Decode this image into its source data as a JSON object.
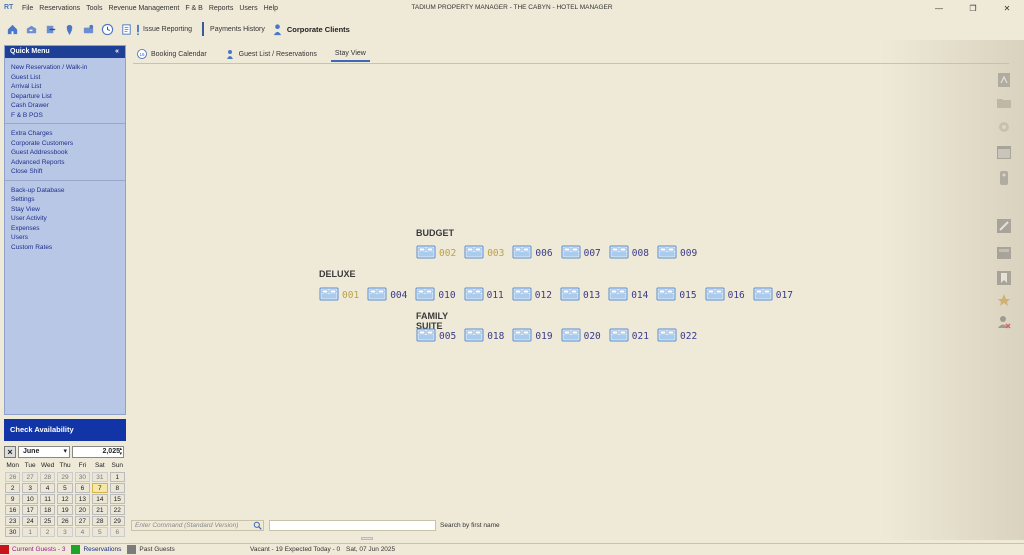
{
  "app": {
    "title": "TADIUM PROPERTY MANAGER - THE CABYN - HOTEL MANAGER",
    "logo": "RT"
  },
  "menu": [
    "File",
    "Reservations",
    "Tools",
    "Revenue Management",
    "F & B",
    "Reports",
    "Users",
    "Help"
  ],
  "window_controls": {
    "minimize": "—",
    "maximize": "❐",
    "close": "✕"
  },
  "toolbar": {
    "issue_reporting": "Issue Reporting",
    "payments_history": "Payments History",
    "corporate_clients": "Corporate Clients"
  },
  "quick_menu": {
    "title": "Quick Menu",
    "collapse": "«",
    "groups": [
      [
        "New Reservation / Walk-in",
        "Guest List",
        "Arrival List",
        "Departure List",
        "Cash Drawer",
        "F & B POS"
      ],
      [
        "Extra Charges",
        "Corporate Customers",
        "Guest Addressbook",
        "Advanced Reports",
        "Close Shift"
      ],
      [
        "Back-up Database",
        "Settings",
        "Stay View",
        "User Activity",
        "Expenses",
        "Users",
        "Custom Rates"
      ]
    ]
  },
  "check_availability": "Check Availability",
  "calendar": {
    "month": "June",
    "year": "2,025",
    "day_names": [
      "Mon",
      "Tue",
      "Wed",
      "Thu",
      "Fri",
      "Sat",
      "Sun"
    ],
    "weeks": [
      [
        "26",
        "27",
        "28",
        "29",
        "30",
        "31",
        "1"
      ],
      [
        "2",
        "3",
        "4",
        "5",
        "6",
        "7",
        "8"
      ],
      [
        "9",
        "10",
        "11",
        "12",
        "13",
        "14",
        "15"
      ],
      [
        "16",
        "17",
        "18",
        "19",
        "20",
        "21",
        "22"
      ],
      [
        "23",
        "24",
        "25",
        "26",
        "27",
        "28",
        "29"
      ],
      [
        "30",
        "1",
        "2",
        "3",
        "4",
        "5",
        "6"
      ]
    ],
    "today": "7"
  },
  "tabs": [
    "Booking Calendar",
    "Guest List / Reservations",
    "Stay View"
  ],
  "active_tab": "Stay View",
  "stay_view": {
    "categories": [
      {
        "name": "BUDGET",
        "rooms": [
          {
            "num": "002",
            "occupied": true
          },
          {
            "num": "003",
            "occupied": true
          },
          {
            "num": "006",
            "occupied": false
          },
          {
            "num": "007",
            "occupied": false
          },
          {
            "num": "008",
            "occupied": false
          },
          {
            "num": "009",
            "occupied": false
          }
        ]
      },
      {
        "name": "DELUXE",
        "rooms": [
          {
            "num": "001",
            "occupied": true
          },
          {
            "num": "004",
            "occupied": false
          },
          {
            "num": "010",
            "occupied": false
          },
          {
            "num": "011",
            "occupied": false
          },
          {
            "num": "012",
            "occupied": false
          },
          {
            "num": "013",
            "occupied": false
          },
          {
            "num": "014",
            "occupied": false
          },
          {
            "num": "015",
            "occupied": false
          },
          {
            "num": "016",
            "occupied": false
          },
          {
            "num": "017",
            "occupied": false
          }
        ]
      },
      {
        "name": "FAMILY SUITE",
        "rooms": [
          {
            "num": "005",
            "occupied": false
          },
          {
            "num": "018",
            "occupied": false
          },
          {
            "num": "019",
            "occupied": false
          },
          {
            "num": "020",
            "occupied": false
          },
          {
            "num": "021",
            "occupied": false
          },
          {
            "num": "022",
            "occupied": false
          }
        ]
      }
    ]
  },
  "command": {
    "placeholder": "Enter Command (Standard Version)",
    "name_search_label": "Search by first name"
  },
  "status": {
    "current_guests": "Current Guests - 3",
    "reservations": "Reservations",
    "past_guests": "Past Guests",
    "info": "Vacant - 19  Expected Today - 0",
    "date": "Sat, 07 Jun 2025"
  },
  "colors": {
    "background": "#efe9d8",
    "quick_menu_header": "#1d3f95",
    "quick_menu_bg": "#b9c7e6",
    "room_vacant": "#3a3a8a",
    "room_occupied": "#b9a24a",
    "current_guests": "#c8151b",
    "reservations": "#1fa32a",
    "past_guests": "#7c7c7c"
  }
}
